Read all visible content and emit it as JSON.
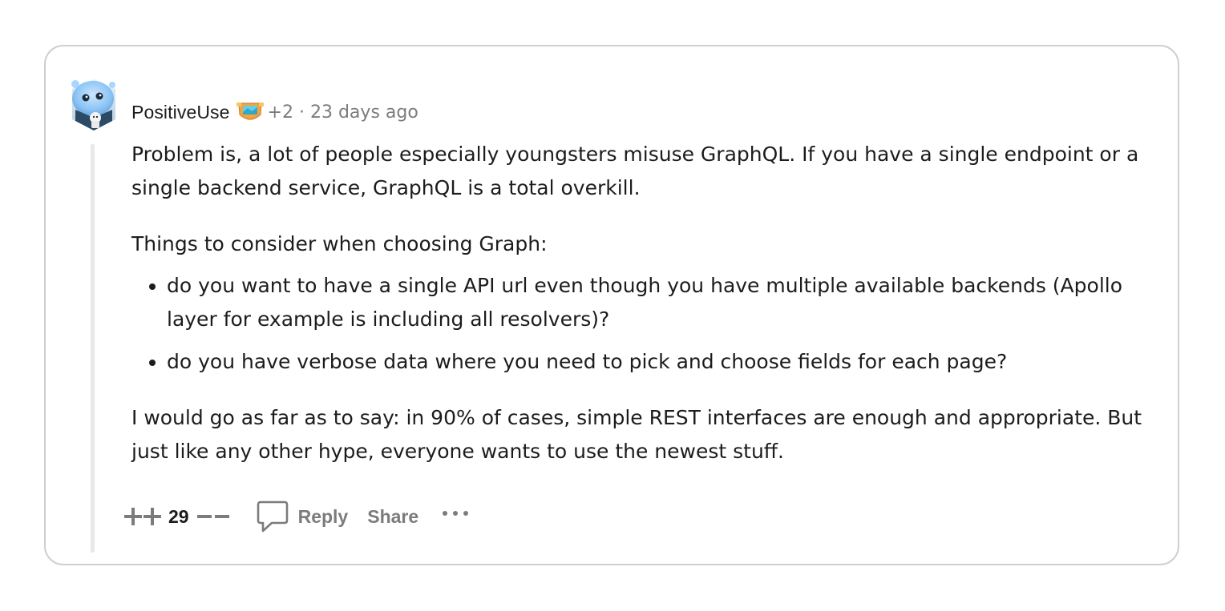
{
  "comment": {
    "username": "PositiveUse",
    "flair_icon": "flair-badge-icon",
    "flair_extra": "+2",
    "separator": "·",
    "timestamp": "23 days ago",
    "paragraphs": [
      "Problem is, a lot of people especially youngsters misuse GraphQL. If you have a single endpoint or a single backend service, GraphQL is a total overkill.",
      "Things to consider when choosing Graph:"
    ],
    "bullets": [
      "do you want to have a single API url even though you have multiple available backends (Apollo layer for example is including all resolvers)?",
      "do you have verbose data where you need to pick and choose fields for each page?"
    ],
    "closing": "I would go as far as to say: in 90% of cases, simple REST interfaces are enough and appropriate. But just like any other hype, everyone wants to use the newest stuff."
  },
  "actions": {
    "upvote_icon": "upvote-plus-icon",
    "score": "29",
    "downvote_icon": "downvote-minus-icon",
    "reply_icon": "speech-bubble-icon",
    "reply_label": "Reply",
    "share_label": "Share",
    "more_icon": "ellipsis-icon"
  },
  "colors": {
    "text": "#1c1c1c",
    "muted": "#7c7c7c",
    "border": "#cfcfcf",
    "thread_line": "#e8e8e8"
  }
}
